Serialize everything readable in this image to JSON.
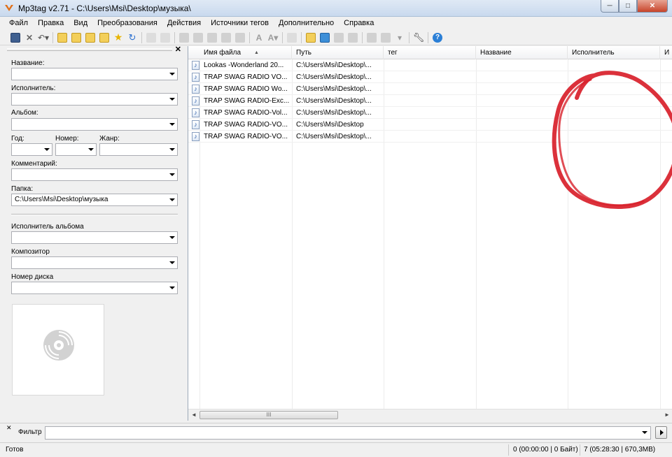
{
  "window": {
    "title": "Mp3tag v2.71  -  C:\\Users\\Msi\\Desktop\\музыка\\",
    "minimize": "─",
    "maximize": "□",
    "close": "✕"
  },
  "menu": [
    "Файл",
    "Правка",
    "Вид",
    "Преобразования",
    "Действия",
    "Источники тегов",
    "Дополнительно",
    "Справка"
  ],
  "toolbar": {
    "icons": [
      "save-icon",
      "remove-tag-icon",
      "undo-icon",
      "change-dir-icon",
      "add-dir-icon",
      "save-playlist-icon",
      "favorites-icon",
      "refresh-icon",
      "copy-icon",
      "paste-icon",
      "tag-filename-icon",
      "filename-tag-icon",
      "text-tag-icon",
      "tag-tag-icon",
      "autonumber-icon",
      "case-convert-icon",
      "extended-tags-icon",
      "export-icon",
      "import-icon",
      "playlist-icon",
      "web-source-icon",
      "cover-icon",
      "actions-icon",
      "options-icon",
      "help-icon"
    ]
  },
  "tag_panel": {
    "close_glyph": "✕",
    "fields": {
      "title_label": "Название:",
      "artist_label": "Исполнитель:",
      "album_label": "Альбом:",
      "year_label": "Год:",
      "track_label": "Номер:",
      "genre_label": "Жанр:",
      "comment_label": "Комментарий:",
      "folder_label": "Папка:",
      "folder_value": "C:\\Users\\Msi\\Desktop\\музыка",
      "album_artist_label": "Исполнитель альбома",
      "composer_label": "Композитор",
      "disc_label": "Номер диска"
    }
  },
  "file_list": {
    "columns": [
      "Имя файла",
      "Путь",
      "тег",
      "Название",
      "Исполнитель",
      "И"
    ],
    "sort_glyph": "▲",
    "rows": [
      {
        "filename": "Lookas -Wonderland 20...",
        "path": "C:\\Users\\Msi\\Desktop\\..."
      },
      {
        "filename": "TRAP SWAG RADIO VO...",
        "path": "C:\\Users\\Msi\\Desktop\\..."
      },
      {
        "filename": "TRAP SWAG RADIO Wo...",
        "path": "C:\\Users\\Msi\\Desktop\\..."
      },
      {
        "filename": "TRAP SWAG RADIO-Exc...",
        "path": "C:\\Users\\Msi\\Desktop\\..."
      },
      {
        "filename": "TRAP SWAG RADIO-Vol...",
        "path": "C:\\Users\\Msi\\Desktop\\..."
      },
      {
        "filename": "TRAP SWAG RADIO-VO...",
        "path": "C:\\Users\\Msi\\Desktop"
      },
      {
        "filename": "TRAP SWAG RADIO-VO...",
        "path": "C:\\Users\\Msi\\Desktop\\..."
      }
    ],
    "note_glyph": "♪",
    "scroll_left": "◄",
    "scroll_right": "►",
    "scroll_grip": "III"
  },
  "filter": {
    "close_glyph": "✕",
    "label": "Фильтр",
    "value": ""
  },
  "status": {
    "left": "Готов",
    "selected": "0 (00:00:00 | 0 Байт)",
    "total": "7 (05:28:30 | 670,3MB)"
  },
  "colors": {
    "scribble": "#d8202a",
    "accent": "#2a5aa8"
  }
}
